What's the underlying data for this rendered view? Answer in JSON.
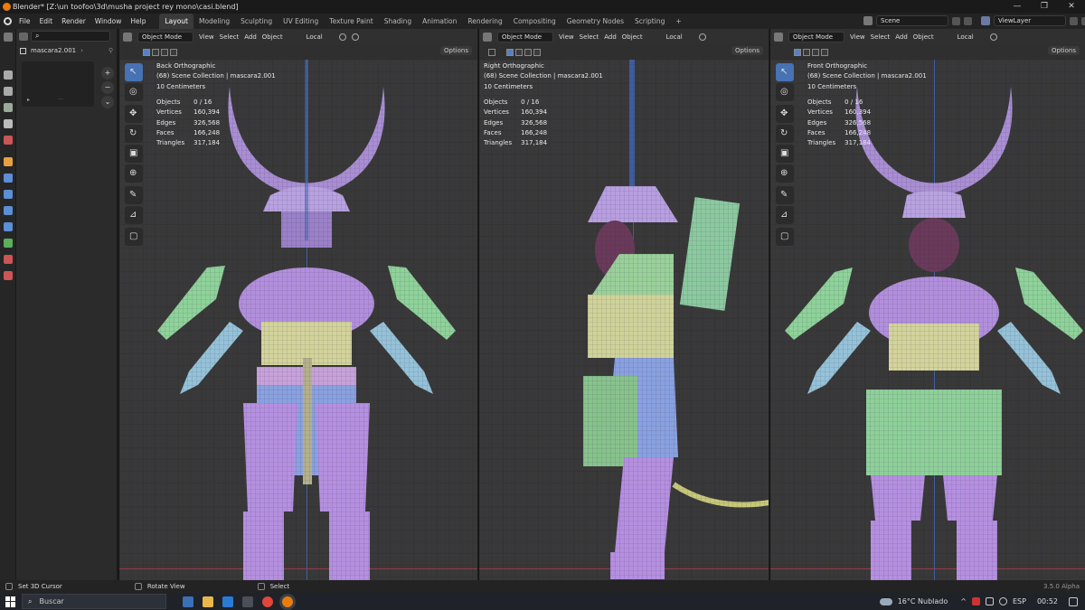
{
  "window": {
    "title": "Blender* [Z:\\un toofoo\\3d\\musha project rey mono\\casi.blend]",
    "controls": [
      "—",
      "❐",
      "✕"
    ]
  },
  "menus": [
    "File",
    "Edit",
    "Render",
    "Window",
    "Help"
  ],
  "workspaces": [
    "Layout",
    "Modeling",
    "Sculpting",
    "UV Editing",
    "Texture Paint",
    "Shading",
    "Animation",
    "Rendering",
    "Compositing",
    "Geometry Nodes",
    "Scripting",
    "+"
  ],
  "active_workspace": "Layout",
  "scene": "Scene",
  "view_layer": "ViewLayer",
  "outliner": {
    "search_placeholder": "",
    "object_name": "mascara2.001"
  },
  "viewport_header": {
    "mode": "Object Mode",
    "menus": [
      "View",
      "Select",
      "Add",
      "Object"
    ],
    "transform": "Local",
    "options": "Options"
  },
  "viewports": [
    {
      "name": "Back Orthographic",
      "collection": "(68) Scene Collection | mascara2.001",
      "scale": "10 Centimeters",
      "stats": [
        {
          "label": "Objects",
          "value": "0 / 16"
        },
        {
          "label": "Vertices",
          "value": "160,394"
        },
        {
          "label": "Edges",
          "value": "326,568"
        },
        {
          "label": "Faces",
          "value": "166,248"
        },
        {
          "label": "Triangles",
          "value": "317,184"
        }
      ]
    },
    {
      "name": "Right Orthographic",
      "collection": "(68) Scene Collection | mascara2.001",
      "scale": "10 Centimeters",
      "stats": [
        {
          "label": "Objects",
          "value": "0 / 16"
        },
        {
          "label": "Vertices",
          "value": "160,394"
        },
        {
          "label": "Edges",
          "value": "326,568"
        },
        {
          "label": "Faces",
          "value": "166,248"
        },
        {
          "label": "Triangles",
          "value": "317,184"
        }
      ]
    },
    {
      "name": "Front Orthographic",
      "collection": "(68) Scene Collection | mascara2.001",
      "scale": "10 Centimeters",
      "stats": [
        {
          "label": "Objects",
          "value": "0 / 16"
        },
        {
          "label": "Vertices",
          "value": "160,394"
        },
        {
          "label": "Edges",
          "value": "326,568"
        },
        {
          "label": "Faces",
          "value": "166,248"
        },
        {
          "label": "Triangles",
          "value": "317,184"
        }
      ]
    }
  ],
  "statusbar": {
    "left": "Set 3D Cursor",
    "middle": "Rotate View",
    "select": "Select",
    "version": "3.5.0 Alpha"
  },
  "taskbar": {
    "search_placeholder": "Buscar",
    "weather": "16°C  Nublado",
    "lang": "ESP",
    "time": "00:52"
  },
  "colors": {
    "mesh_purple": "#b08fd6",
    "mesh_blue": "#8aa4e0",
    "mesh_green": "#9ccf9a",
    "mesh_yellow": "#d6d79a",
    "mesh_teal": "#93c3d8",
    "accent_blue": "#4772b3",
    "blender_orange": "#e87d0d"
  }
}
